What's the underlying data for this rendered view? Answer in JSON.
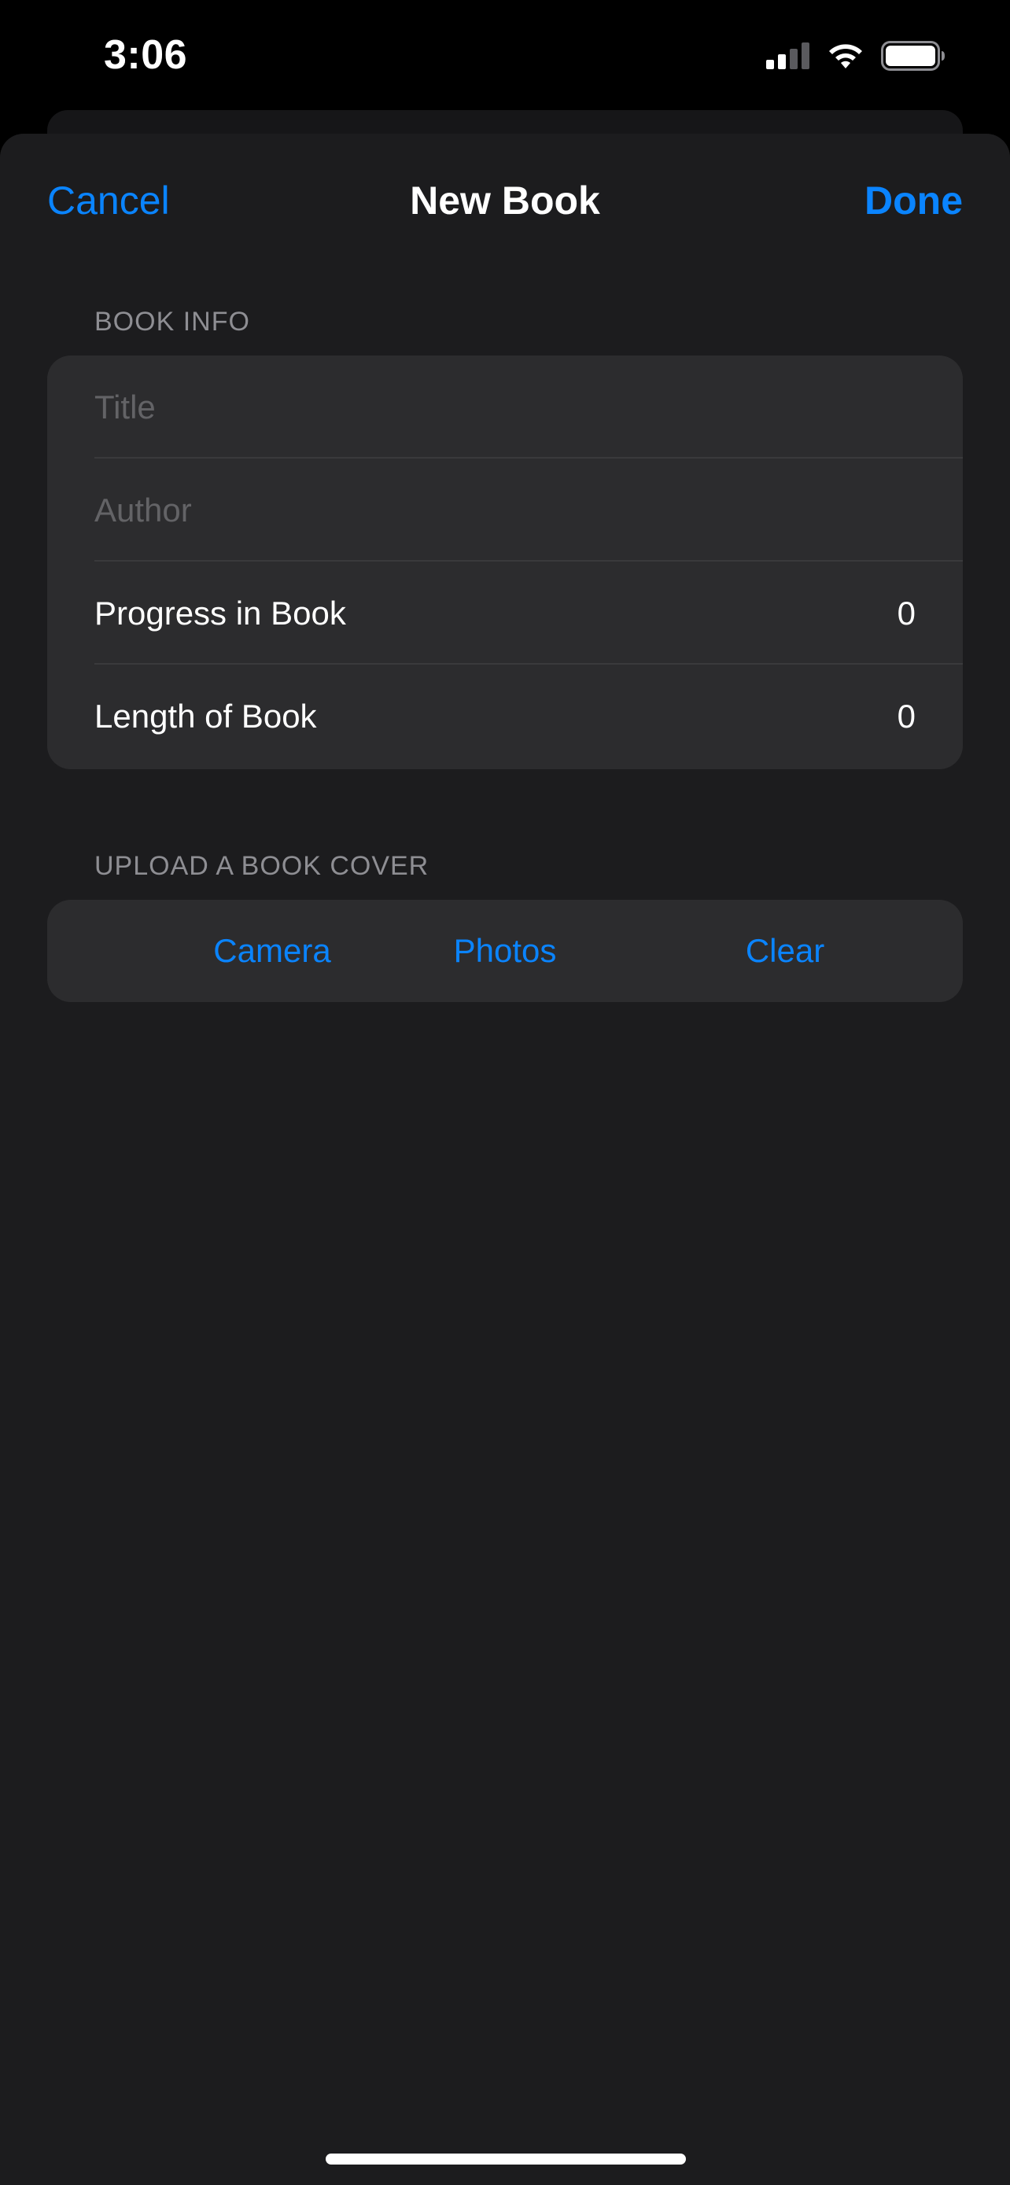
{
  "status_bar": {
    "time": "3:06",
    "icons": [
      "signal-icon",
      "wifi-icon",
      "battery-icon"
    ]
  },
  "nav": {
    "cancel_label": "Cancel",
    "title": "New Book",
    "done_label": "Done"
  },
  "book_info": {
    "header": "BOOK INFO",
    "title_placeholder": "Title",
    "author_placeholder": "Author",
    "progress_label": "Progress in Book",
    "progress_value": "0",
    "length_label": "Length of Book",
    "length_value": "0"
  },
  "book_cover": {
    "header": "UPLOAD A BOOK COVER",
    "camera_label": "Camera",
    "photos_label": "Photos",
    "clear_label": "Clear"
  },
  "colors": {
    "accent": "#0a84ff",
    "sheet_background": "#1c1c1e",
    "group_background": "#2c2c2e",
    "secondary_text": "#8e8e93",
    "placeholder_text": "#636366"
  }
}
